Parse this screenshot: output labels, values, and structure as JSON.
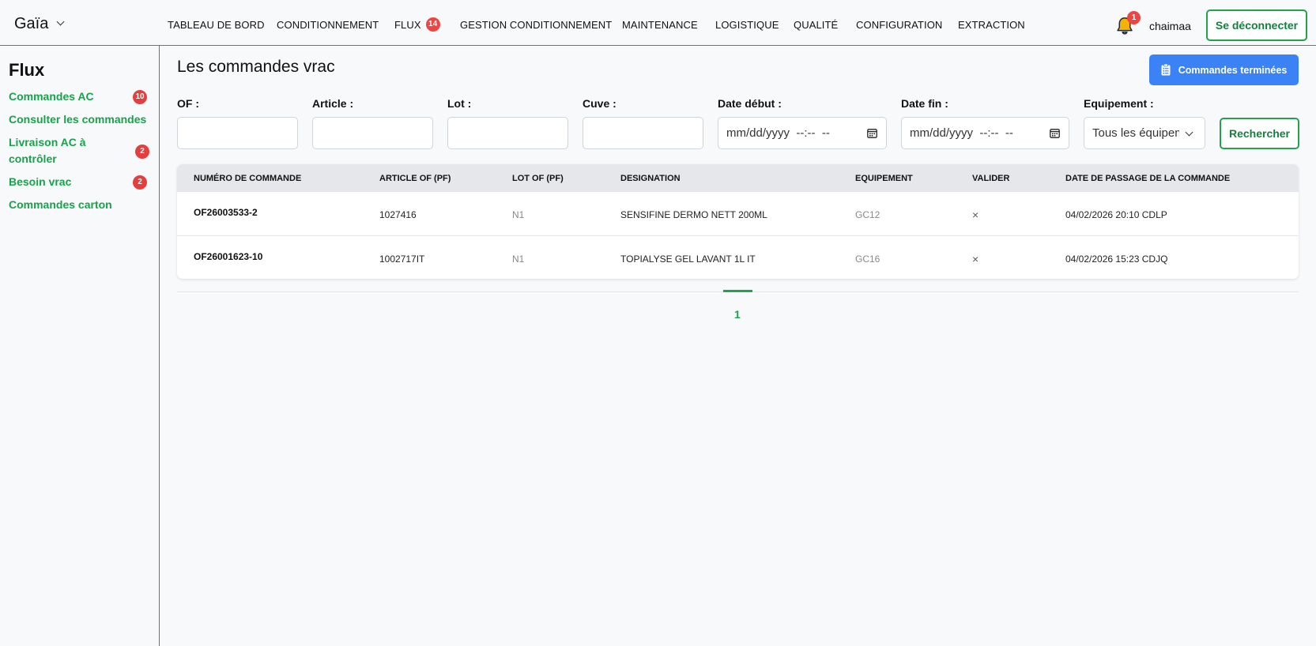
{
  "app": {
    "brand": "Gaïa"
  },
  "nav": {
    "items": [
      {
        "label": "TABLEAU DE BORD"
      },
      {
        "label": "CONDITIONNEMENT"
      },
      {
        "label": "FLUX",
        "badge": "14"
      },
      {
        "label": "GESTION CONDITIONNEMENT"
      },
      {
        "label": "MAINTENANCE"
      },
      {
        "label": "LOGISTIQUE"
      },
      {
        "label": "QUALITÉ"
      },
      {
        "label": "CONFIGURATION"
      },
      {
        "label": "EXTRACTION"
      }
    ],
    "notifications_badge": "1",
    "username": "chaimaa",
    "logout_label": "Se déconnecter"
  },
  "sidebar": {
    "title": "Flux",
    "items": [
      {
        "label": "Commandes AC",
        "badge": "10"
      },
      {
        "label": "Consulter les commandes"
      },
      {
        "label": "Livraison AC à contrôler",
        "badge": "2"
      },
      {
        "label": "Besoin vrac",
        "badge": "2"
      },
      {
        "label": "Commandes carton"
      }
    ]
  },
  "main": {
    "title": "Les commandes vrac",
    "done_button": "Commandes terminées",
    "filters": {
      "of_label": "OF :",
      "article_label": "Article :",
      "lot_label": "Lot :",
      "cuve_label": "Cuve :",
      "date_start_label": "Date début :",
      "date_start_placeholder": "mm/dd/yyyy  --:--  --",
      "date_end_label": "Date fin :",
      "date_end_placeholder": "mm/dd/yyyy  --:--  --",
      "equipment_label": "Equipement :",
      "equipment_value": "Tous les équipem",
      "search_button": "Rechercher"
    },
    "table": {
      "columns": [
        "NUMÉRO DE COMMANDE",
        "ARTICLE OF (PF)",
        "LOT OF (PF)",
        "DESIGNATION",
        "EQUIPEMENT",
        "VALIDER",
        "DATE DE PASSAGE DE LA COMMANDE"
      ],
      "rows": [
        {
          "commande": "OF26003533-2",
          "article": "1027416",
          "lot": "N1",
          "designation": "SENSIFINE DERMO NETT 200ML",
          "equipement": "GC12",
          "valider": "×",
          "date": "04/02/2026 20:10 CDLP"
        },
        {
          "commande": "OF26001623-10",
          "article": "1002717IT",
          "lot": "N1",
          "designation": "TOPIALYSE GEL LAVANT 1L IT",
          "equipement": "GC16",
          "valider": "×",
          "date": "04/02/2026 15:23 CDJQ"
        }
      ]
    },
    "pagination": {
      "current": "1"
    }
  },
  "colors": {
    "accent_green": "#22a24a",
    "primary_blue": "#3b82f6",
    "badge_red": "#ef4444"
  }
}
